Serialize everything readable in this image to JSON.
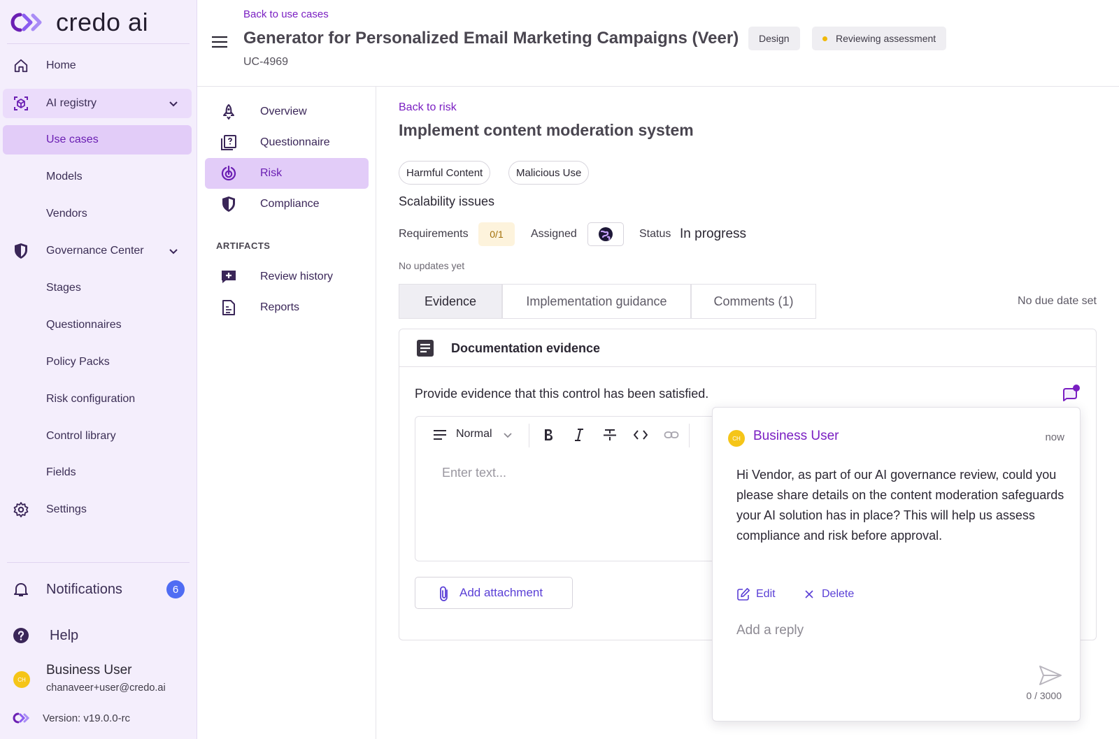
{
  "app": {
    "logo_text": "credo ai"
  },
  "sidebar": {
    "items": [
      {
        "label": "Home"
      },
      {
        "label": "AI registry"
      },
      {
        "label": "Use cases"
      },
      {
        "label": "Models"
      },
      {
        "label": "Vendors"
      },
      {
        "label": "Governance Center"
      },
      {
        "label": "Stages"
      },
      {
        "label": "Questionnaires"
      },
      {
        "label": "Policy Packs"
      },
      {
        "label": "Risk configuration"
      },
      {
        "label": "Control library"
      },
      {
        "label": "Fields"
      },
      {
        "label": "Settings"
      }
    ],
    "notifications": {
      "label": "Notifications",
      "count": "6"
    },
    "help": "Help",
    "user": {
      "name": "Business User",
      "email": "chanaveer+user@credo.ai",
      "initials": "CH"
    },
    "version": "Version: v19.0.0-rc"
  },
  "header": {
    "back_link": "Back to use cases",
    "title": "Generator for Personalized Email Marketing Campaigns (Veer)",
    "stage_pill": "Design",
    "status_pill": "Reviewing assessment",
    "id": "UC-4969"
  },
  "subnav": {
    "items": [
      {
        "label": "Overview"
      },
      {
        "label": "Questionnaire"
      },
      {
        "label": "Risk"
      },
      {
        "label": "Compliance"
      }
    ],
    "section_label": "ARTIFACTS",
    "artifacts": [
      {
        "label": "Review history"
      },
      {
        "label": "Reports"
      }
    ]
  },
  "main": {
    "back_link": "Back to risk",
    "title": "Implement content moderation system",
    "tags": [
      "Harmful Content",
      "Malicious Use"
    ],
    "subtitle": "Scalability issues",
    "requirements_label": "Requirements",
    "requirements_value": "0/1",
    "assigned_label": "Assigned",
    "status_label": "Status",
    "status_value": "In progress",
    "no_updates": "No updates yet",
    "tabs": [
      "Evidence",
      "Implementation guidance",
      "Comments (1)"
    ],
    "due_date": "No due date set",
    "evidence": {
      "heading": "Documentation evidence",
      "prompt": "Provide evidence that this control has been satisfied.",
      "format_select": "Normal",
      "placeholder": "Enter text...",
      "attach_label": "Add attachment"
    }
  },
  "comment_popover": {
    "author": "Business User",
    "author_initials": "CH",
    "time": "now",
    "body": "Hi Vendor, as part of our AI governance review, could you please share details on the content moderation safeguards your AI solution has in place? This will help us assess compliance and risk before approval.",
    "edit_label": "Edit",
    "delete_label": "Delete",
    "reply_placeholder": "Add a reply",
    "char_count": "0 / 3000"
  },
  "colors": {
    "brand_purple": "#7a1fc2",
    "sidebar_bg": "#f4eefc",
    "active_nav": "#e2ccf8",
    "badge_blue": "#4f6cf3",
    "status_dot": "#f0b90b"
  }
}
